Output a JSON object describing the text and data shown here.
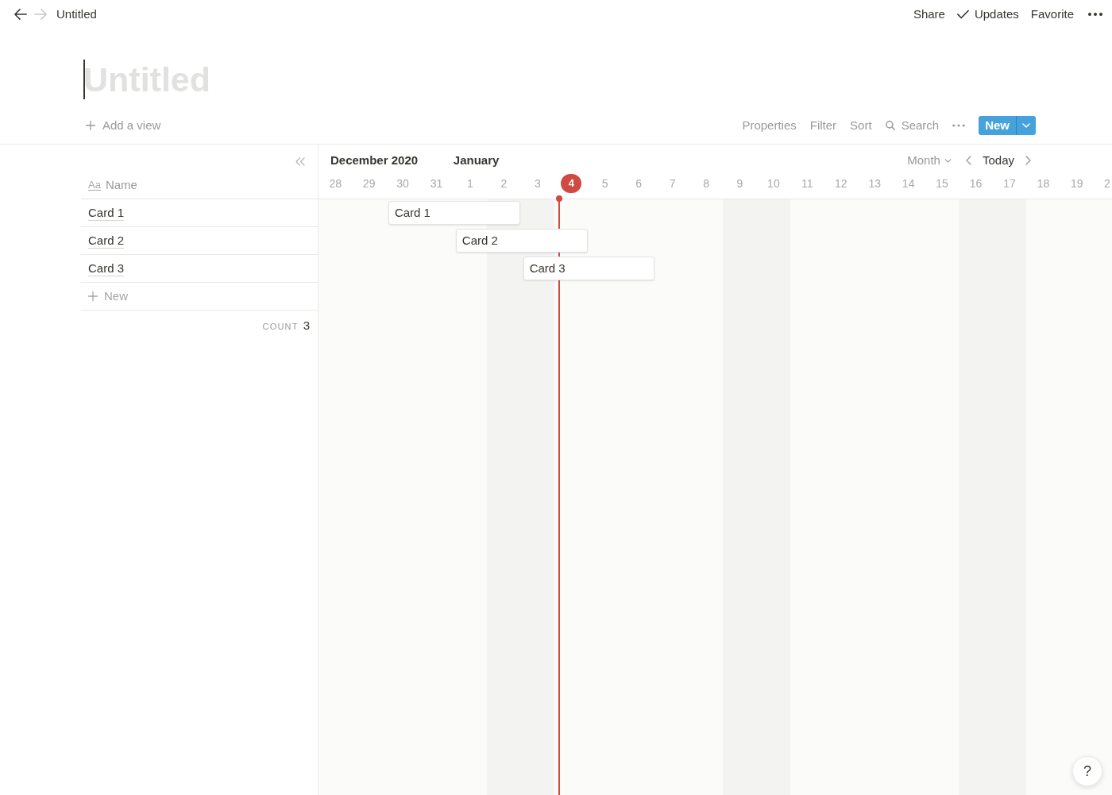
{
  "nav": {
    "back": {
      "disabled": false
    },
    "forward": {
      "disabled": true
    }
  },
  "breadcrumb": "Untitled",
  "actions": [
    {
      "label": "Share",
      "kind": "text"
    },
    {
      "label": "Updates",
      "kind": "icon-text"
    },
    {
      "label": "Favorite",
      "kind": "text"
    }
  ],
  "title": {
    "placeholder": "Untitled",
    "focused": true
  },
  "view_bar": {
    "add_view": "Add a view",
    "tools": [
      "Properties",
      "Filter",
      "Sort"
    ],
    "search": "Search",
    "new_button": "New"
  },
  "table": {
    "type_icon": "Aa",
    "column": "Name",
    "rows": [
      {
        "name": "Card 1",
        "bar_label": "Card 1"
      },
      {
        "name": "Card 2",
        "bar_label": "Card 2"
      },
      {
        "name": "Card 3",
        "bar_label": "Card 3"
      }
    ],
    "new_row": "New",
    "count_label": "COUNT",
    "count": "3"
  },
  "timeline": {
    "months": [
      {
        "label": "December 2020",
        "days": [
          {
            "label": "28",
            "weekend": false,
            "today": false
          },
          {
            "label": "29",
            "weekend": false,
            "today": false
          },
          {
            "label": "30",
            "weekend": false,
            "today": false
          },
          {
            "label": "31",
            "weekend": false,
            "today": false
          }
        ]
      },
      {
        "label": "January",
        "days": [
          {
            "label": "1",
            "weekend": false,
            "today": false
          },
          {
            "label": "2",
            "weekend": true,
            "today": false
          },
          {
            "label": "3",
            "weekend": true,
            "today": false
          },
          {
            "label": "4",
            "weekend": false,
            "today": true
          },
          {
            "label": "5",
            "weekend": false,
            "today": false
          },
          {
            "label": "6",
            "weekend": false,
            "today": false
          },
          {
            "label": "7",
            "weekend": false,
            "today": false
          },
          {
            "label": "8",
            "weekend": false,
            "today": false
          },
          {
            "label": "9",
            "weekend": true,
            "today": false
          },
          {
            "label": "10",
            "weekend": true,
            "today": false
          },
          {
            "label": "11",
            "weekend": false,
            "today": false
          },
          {
            "label": "12",
            "weekend": false,
            "today": false
          },
          {
            "label": "13",
            "weekend": false,
            "today": false
          },
          {
            "label": "14",
            "weekend": false,
            "today": false
          },
          {
            "label": "15",
            "weekend": false,
            "today": false
          },
          {
            "label": "16",
            "weekend": true,
            "today": false
          },
          {
            "label": "17",
            "weekend": true,
            "today": false
          },
          {
            "label": "18",
            "weekend": false,
            "today": false
          },
          {
            "label": "19",
            "weekend": false,
            "today": false
          },
          {
            "label": "2",
            "weekend": false,
            "today": false
          }
        ]
      }
    ],
    "view_select": "Month",
    "today_button": "Today"
  },
  "help_button": "?"
}
